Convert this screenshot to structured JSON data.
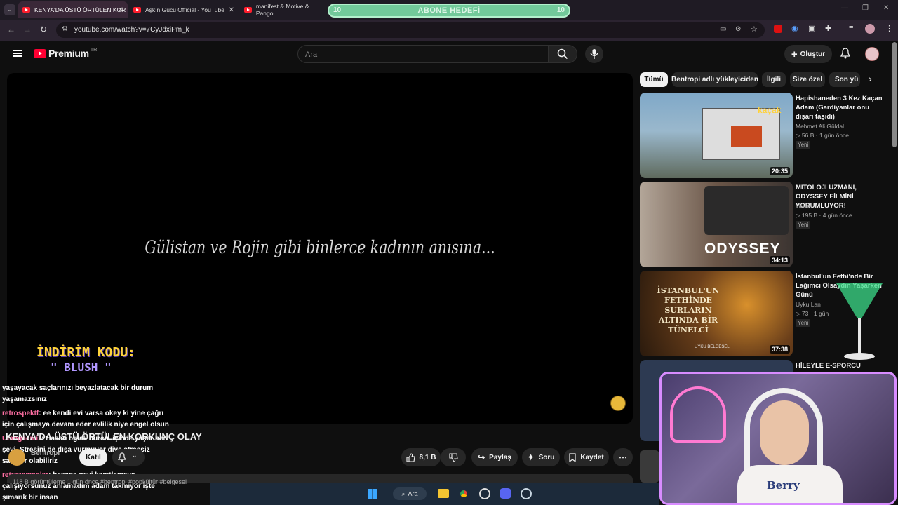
{
  "browser": {
    "tabs": [
      {
        "label": "KENYA'DA ÜSTÜ ÖRTÜLEN KOR"
      },
      {
        "label": "Aşkın Gücü Official - YouTube"
      },
      {
        "label": "manifest & Motive & Pango"
      }
    ],
    "subscriber_goal": {
      "label": "ABONE HEDEFİ",
      "left_count": "10",
      "right_count": "10"
    },
    "url": "youtube.com/watch?v=7CyJdxiPm_k"
  },
  "header": {
    "logo": "Premium",
    "region": "TR",
    "search_placeholder": "Ara",
    "create_label": "Oluştur"
  },
  "player": {
    "quote": "Gülistan ve Rojin gibi binlerce kadının anısına...",
    "promo_line1": "İNDİRİM KODU:",
    "promo_line2": "\" BLUSH \""
  },
  "chat": {
    "lines": [
      {
        "user": "",
        "text": "yaşayacak saçlarınızı beyazlatacak bir durum"
      },
      {
        "user": "",
        "text": "yaşamazsınız"
      },
      {
        "user": "retrospektf",
        "text": ": ee kendi evi varsa okey ki yine çağrı"
      },
      {
        "user": "",
        "text": "için çalışmaya devam eder evlilik niye engel olsun"
      },
      {
        "user": "Utangacmiz",
        "text": ": Hasan oğlak burcu. içinde yaşar her"
      },
      {
        "user": "",
        "text": "şeyi. Stresini de dışa vurmuyor diye stressiz"
      },
      {
        "user": "",
        "text": "sanıyor olabiliriz"
      },
      {
        "user": "retrozamanlar",
        "text": ": hasana neyi kanıtlamaya"
      },
      {
        "user": "",
        "text": "çalışıyorsunuz anlamadım adam takmıyor işte"
      },
      {
        "user": "",
        "text": "şımarık bir insan"
      }
    ]
  },
  "video": {
    "title": "KENYA'DA ÜSTÜ ÖRTÜLEN KORKUNÇ OLAY",
    "channel": "Bentropi",
    "join_label": "Katıl",
    "likes": "8,1 B",
    "share_label": "Paylaş",
    "ask_label": "Soru",
    "save_label": "Kaydet",
    "meta": "118 B görüntüleme  1 gün önce  #bentropi #popkültür #belgesel"
  },
  "chips": [
    "Tümü",
    "Bentropi adlı yükleyiciden",
    "İlgili",
    "Size özel",
    "Son yü"
  ],
  "recommendations": [
    {
      "title": "Hapishaneden 3 Kez Kaçan Adam (Gardiyanlar onu dışarı taşıdı)",
      "channel": "Mehmet Ali Güldal",
      "views": "56 B",
      "age": "1 gün önce",
      "badge": "Yeni",
      "duration": "20:35",
      "thumb_text": "kaçak"
    },
    {
      "title": "MİTOLOJİ UZMANI, ODYSSEY FİLMİNİ YORUMLUYOR!",
      "channel": "Literat",
      "views": "195 B",
      "age": "4 gün önce",
      "badge": "Yeni",
      "duration": "34:13",
      "thumb_text": "ODYSSEY"
    },
    {
      "title": "İstanbul'un Fethi'nde Bir Lağımcı Olsaydın Yaşarken Günü",
      "channel": "Uyku Lan",
      "views": "73",
      "age": "1 gün",
      "badge": "Yeni",
      "duration": "37:38",
      "thumb_text": "İSTANBUL'UN FETHİNDE SURLARIN ALTINDA BİR TÜNELCİ",
      "thumb_sub": "UYKU BELGESELİ"
    },
    {
      "title": "HİLEYLE E-SPORCU OLDUM!",
      "channel": "",
      "views": "",
      "age": "",
      "badge": "",
      "duration": "",
      "thumb_text": ""
    }
  ],
  "taskbar": {
    "search_label": "Ara"
  }
}
